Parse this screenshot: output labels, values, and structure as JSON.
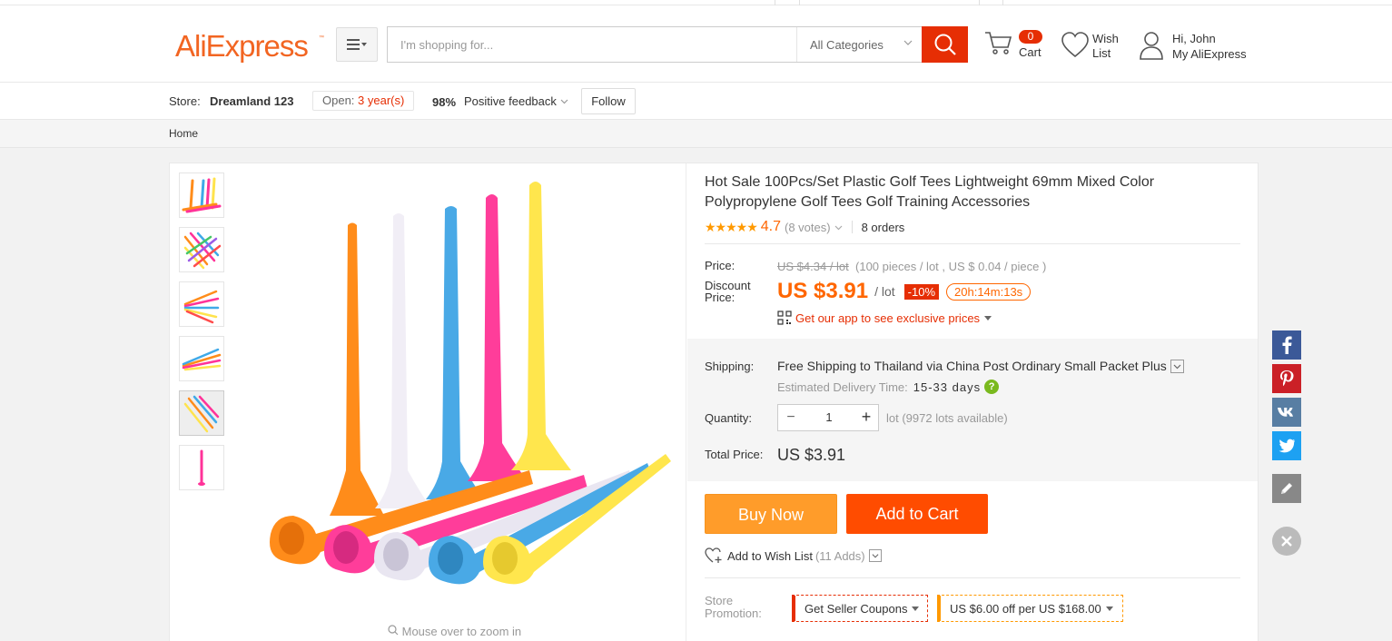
{
  "header": {
    "logo_text": "AliExpress",
    "search_placeholder": "I'm shopping for...",
    "category": "All Categories",
    "cart_count": "0",
    "cart_label": "Cart",
    "wish_label_1": "Wish",
    "wish_label_2": "List",
    "greeting": "Hi, John",
    "account_label": "My AliExpress"
  },
  "store": {
    "label": "Store:",
    "name": "Dreamland 123",
    "open_label": "Open:",
    "open_years": "3 year(s)",
    "feedback_pct": "98%",
    "feedback_label": "Positive feedback",
    "follow_label": "Follow"
  },
  "breadcrumb": {
    "home": "Home"
  },
  "gallery": {
    "zoom_hint": "Mouse over to zoom in"
  },
  "product": {
    "title": "Hot Sale 100Pcs/Set Plastic Golf Tees Lightweight 69mm Mixed Color Polypropylene Golf Tees Golf Training Accessories",
    "rating": "4.7",
    "votes": "(8 votes)",
    "orders": "8 orders",
    "price_label": "Price:",
    "old_price": "US $4.34 / lot",
    "old_price_detail": "(100 pieces / lot , US $ 0.04 / piece )",
    "discount_label_1": "Discount",
    "discount_label_2": "Price:",
    "discount_price": "US $3.91",
    "discount_unit": "/ lot",
    "discount_pct": "-10%",
    "timer": "20h:14m:13s",
    "app_link": "Get our app to see exclusive prices",
    "shipping_label": "Shipping:",
    "shipping_free": "Free Shipping",
    "shipping_to": " to ",
    "shipping_dest": "Thailand via China Post Ordinary Small Packet Plus",
    "est_label": "Estimated Delivery Time:",
    "est_days": "15-33 days",
    "quantity_label": "Quantity:",
    "quantity": "1",
    "quantity_note": "lot (9972 lots available)",
    "total_label": "Total Price:",
    "total": "US $3.91",
    "buy_now": "Buy Now",
    "add_to_cart": "Add to Cart",
    "wish_add": "Add to Wish List",
    "wish_adds": "(11 Adds)",
    "promo_label_1": "Store",
    "promo_label_2": "Promotion:",
    "coupon_1": "Get Seller Coupons",
    "coupon_2_a": "US $6.00",
    "coupon_2_b": " off per ",
    "coupon_2_c": "US $168.00"
  },
  "colors": {
    "accent": "#e62e04",
    "price": "#ff6600",
    "buy_now": "#ff9c2a",
    "add_to_cart": "#ff4c00",
    "facebook": "#3b5998",
    "pinterest": "#cb2027",
    "vk": "#587ea3",
    "twitter": "#1da1f2"
  },
  "social": [
    "facebook-icon",
    "pinterest-icon",
    "vk-icon",
    "twitter-icon",
    "edit-icon",
    "close-icon"
  ]
}
